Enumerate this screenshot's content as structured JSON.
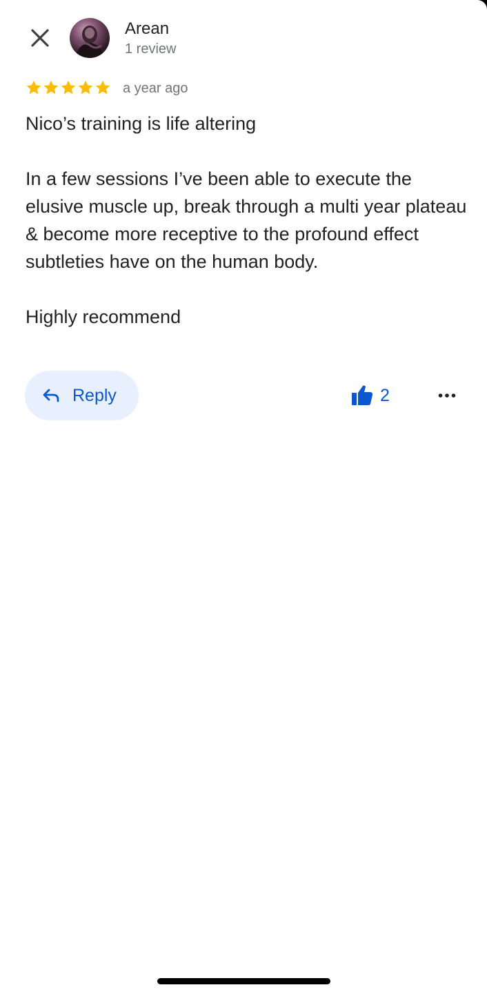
{
  "review": {
    "author": {
      "name": "Arean",
      "meta": "1 review"
    },
    "rating": 5,
    "time_ago": "a year ago",
    "paragraphs": [
      "Nico’s training is life altering",
      "In a few sessions I’ve been able to execute the elusive muscle up, break through a multi year plateau & become more receptive to the profound effect subtleties have on the human body.",
      "Highly recommend"
    ]
  },
  "actions": {
    "reply_label": "Reply",
    "like_count": "2"
  },
  "icons": {
    "close": "close-icon",
    "reply": "reply-arrow-icon",
    "like": "thumbs-up-icon",
    "more": "more-horizontal-icon",
    "star": "star-icon"
  },
  "colors": {
    "accent": "#0b57d0",
    "reply_bg": "#e8f0fe",
    "star": "#fbbc04",
    "text_primary": "#202124",
    "text_secondary": "#70757a"
  }
}
